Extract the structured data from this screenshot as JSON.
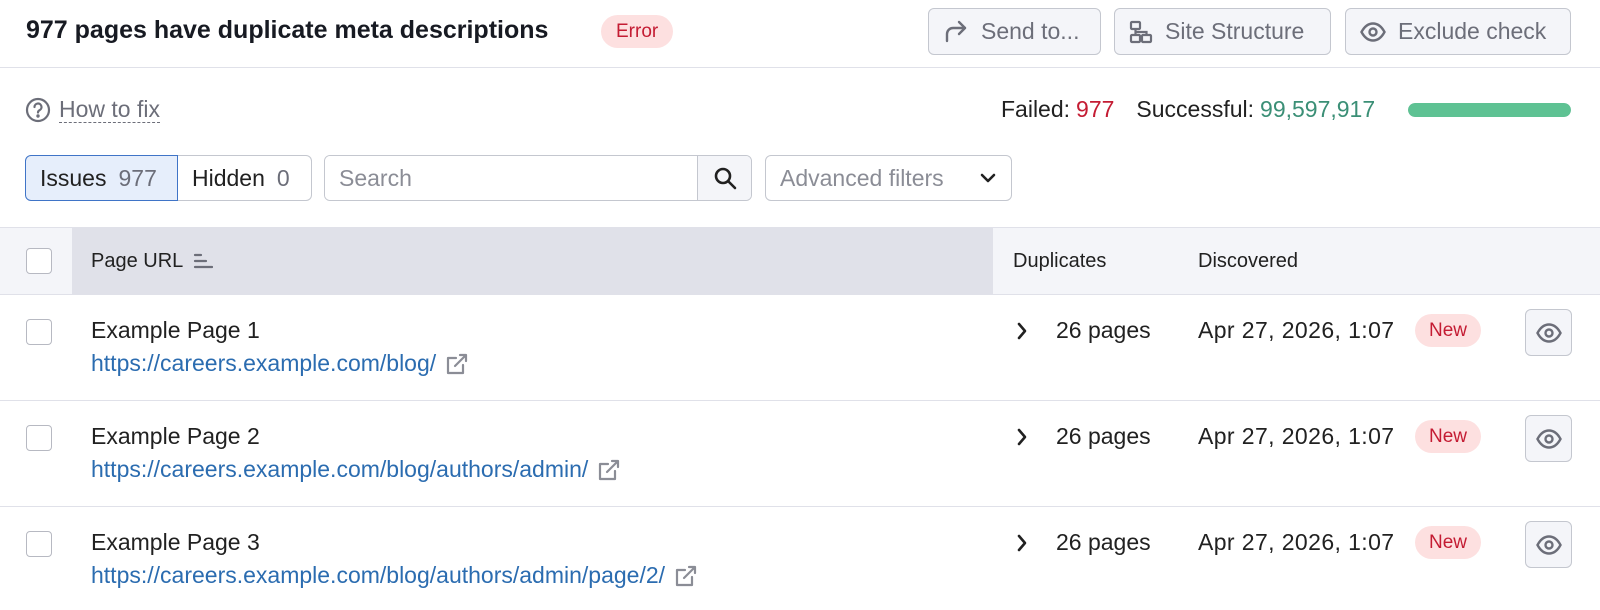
{
  "header": {
    "title": "977 pages have duplicate meta descriptions",
    "status_badge": "Error",
    "send_label": "Send to...",
    "site_structure_label": "Site Structure",
    "exclude_label": "Exclude check"
  },
  "summary": {
    "how_to_fix": "How to fix",
    "failed_label": "Failed:",
    "failed_value": "977",
    "successful_label": "Successful:",
    "successful_value": "99,597,917",
    "success_ratio": 0.99999
  },
  "toolbar": {
    "issues_label": "Issues",
    "issues_count": "977",
    "hidden_label": "Hidden",
    "hidden_count": "0",
    "search_placeholder": "Search",
    "advanced_filters_label": "Advanced filters"
  },
  "table": {
    "columns": {
      "page_url": "Page URL",
      "duplicates": "Duplicates",
      "discovered": "Discovered"
    },
    "rows": [
      {
        "name": "Example Page 1",
        "url": "https://careers.example.com/blog/",
        "duplicates": "26 pages",
        "discovered": "Apr 27, 2026, 1:07",
        "badge": "New"
      },
      {
        "name": "Example Page 2",
        "url": "https://careers.example.com/blog/authors/admin/",
        "duplicates": "26 pages",
        "discovered": "Apr 27, 2026, 1:07",
        "badge": "New"
      },
      {
        "name": "Example Page 3",
        "url": "https://careers.example.com/blog/authors/admin/page/2/",
        "duplicates": "26 pages",
        "discovered": "Apr 27, 2026, 1:07",
        "badge": "New"
      }
    ]
  },
  "colors": {
    "error": "#c41c33",
    "success": "#3b8f76",
    "progress_fill": "#5ec293",
    "link": "#2b6cb0"
  },
  "icons": {
    "send": "share-arrow-icon",
    "site_structure": "sitemap-icon",
    "exclude": "eye-icon",
    "how_to_fix": "question-circle-icon",
    "search": "search-icon",
    "advanced_filters": "chevron-down-icon",
    "sort": "sort-icon",
    "expand": "chevron-right-icon",
    "external": "external-link-icon",
    "row_action": "eye-icon"
  }
}
